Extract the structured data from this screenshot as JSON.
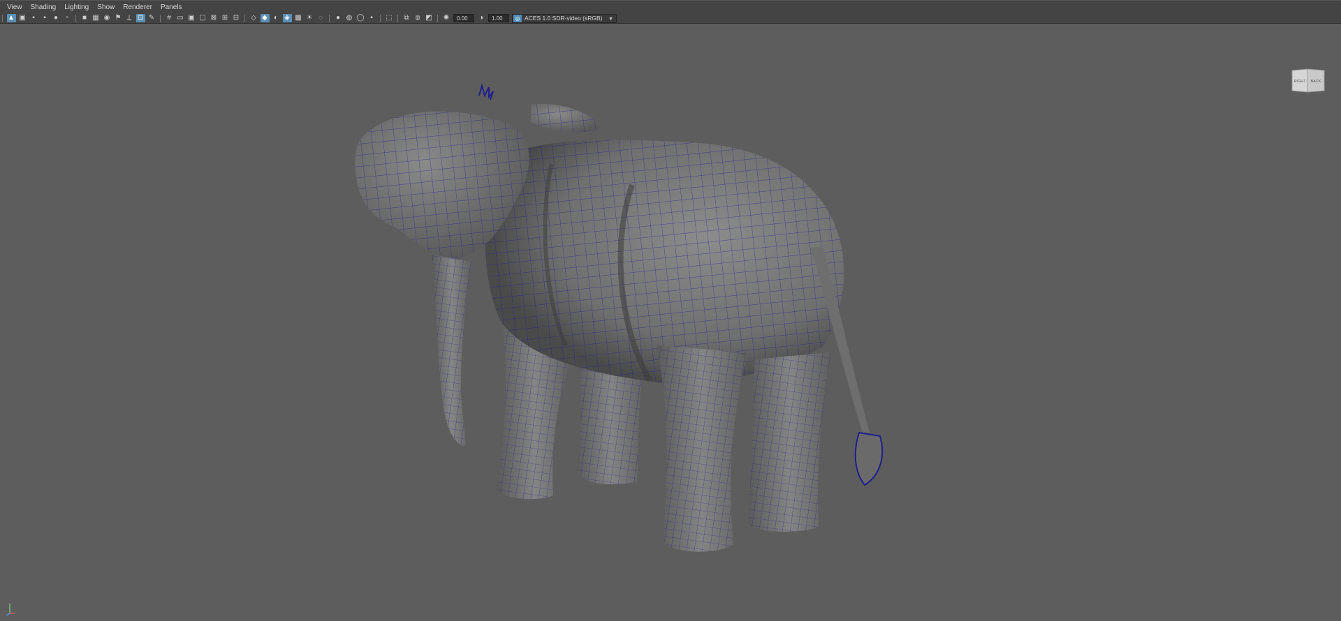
{
  "menu": {
    "items": [
      "View",
      "Shading",
      "Lighting",
      "Show",
      "Renderer",
      "Panels"
    ]
  },
  "toolbar": {
    "exposure_value": "0.00",
    "gamma_value": "1.00",
    "color_space": "ACES 1.0 SDR-video (sRGB)"
  },
  "viewcube": {
    "left_face": "RIGHT",
    "right_face": "BACK"
  },
  "colors": {
    "viewport_bg": "#5d5d5d",
    "wireframe": "#1a1a8a",
    "accent": "#5a8fb3"
  }
}
